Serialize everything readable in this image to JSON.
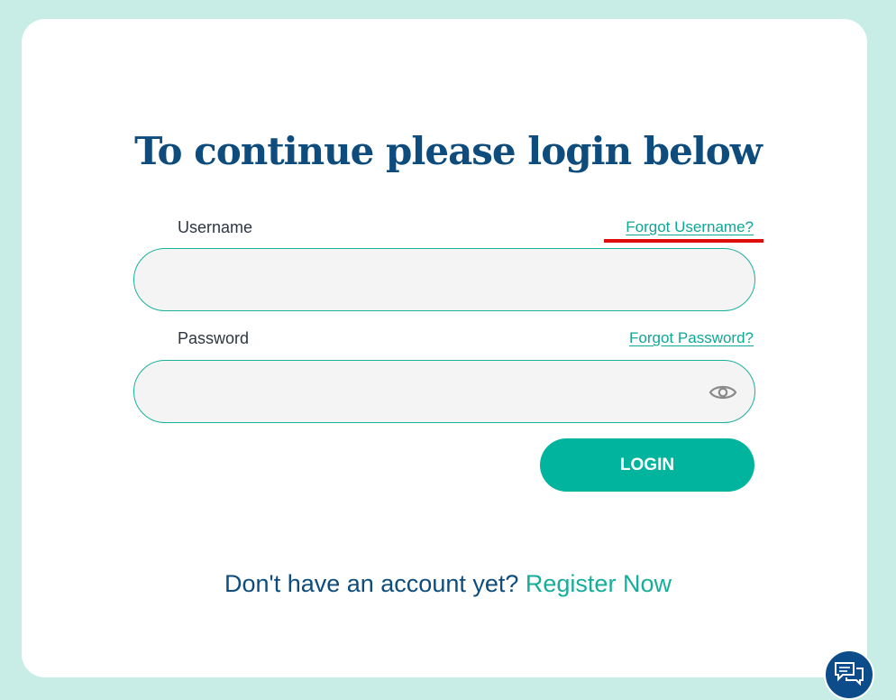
{
  "page": {
    "title": "To continue please login below"
  },
  "form": {
    "username": {
      "label": "Username",
      "forgot_link": "Forgot Username?",
      "value": ""
    },
    "password": {
      "label": "Password",
      "forgot_link": "Forgot Password?",
      "value": ""
    },
    "login_label": "LOGIN"
  },
  "register": {
    "prompt": "Don't have an account yet?",
    "link": "Register Now"
  },
  "icons": {
    "password_toggle": "eye-icon",
    "chat": "chat-bubbles-icon"
  },
  "colors": {
    "background": "#c8ede6",
    "title": "#0d4c7c",
    "accent": "#00b49d",
    "link": "#0fa795",
    "annotation": "#e00d0d",
    "chat_button": "#0d4c8a"
  }
}
